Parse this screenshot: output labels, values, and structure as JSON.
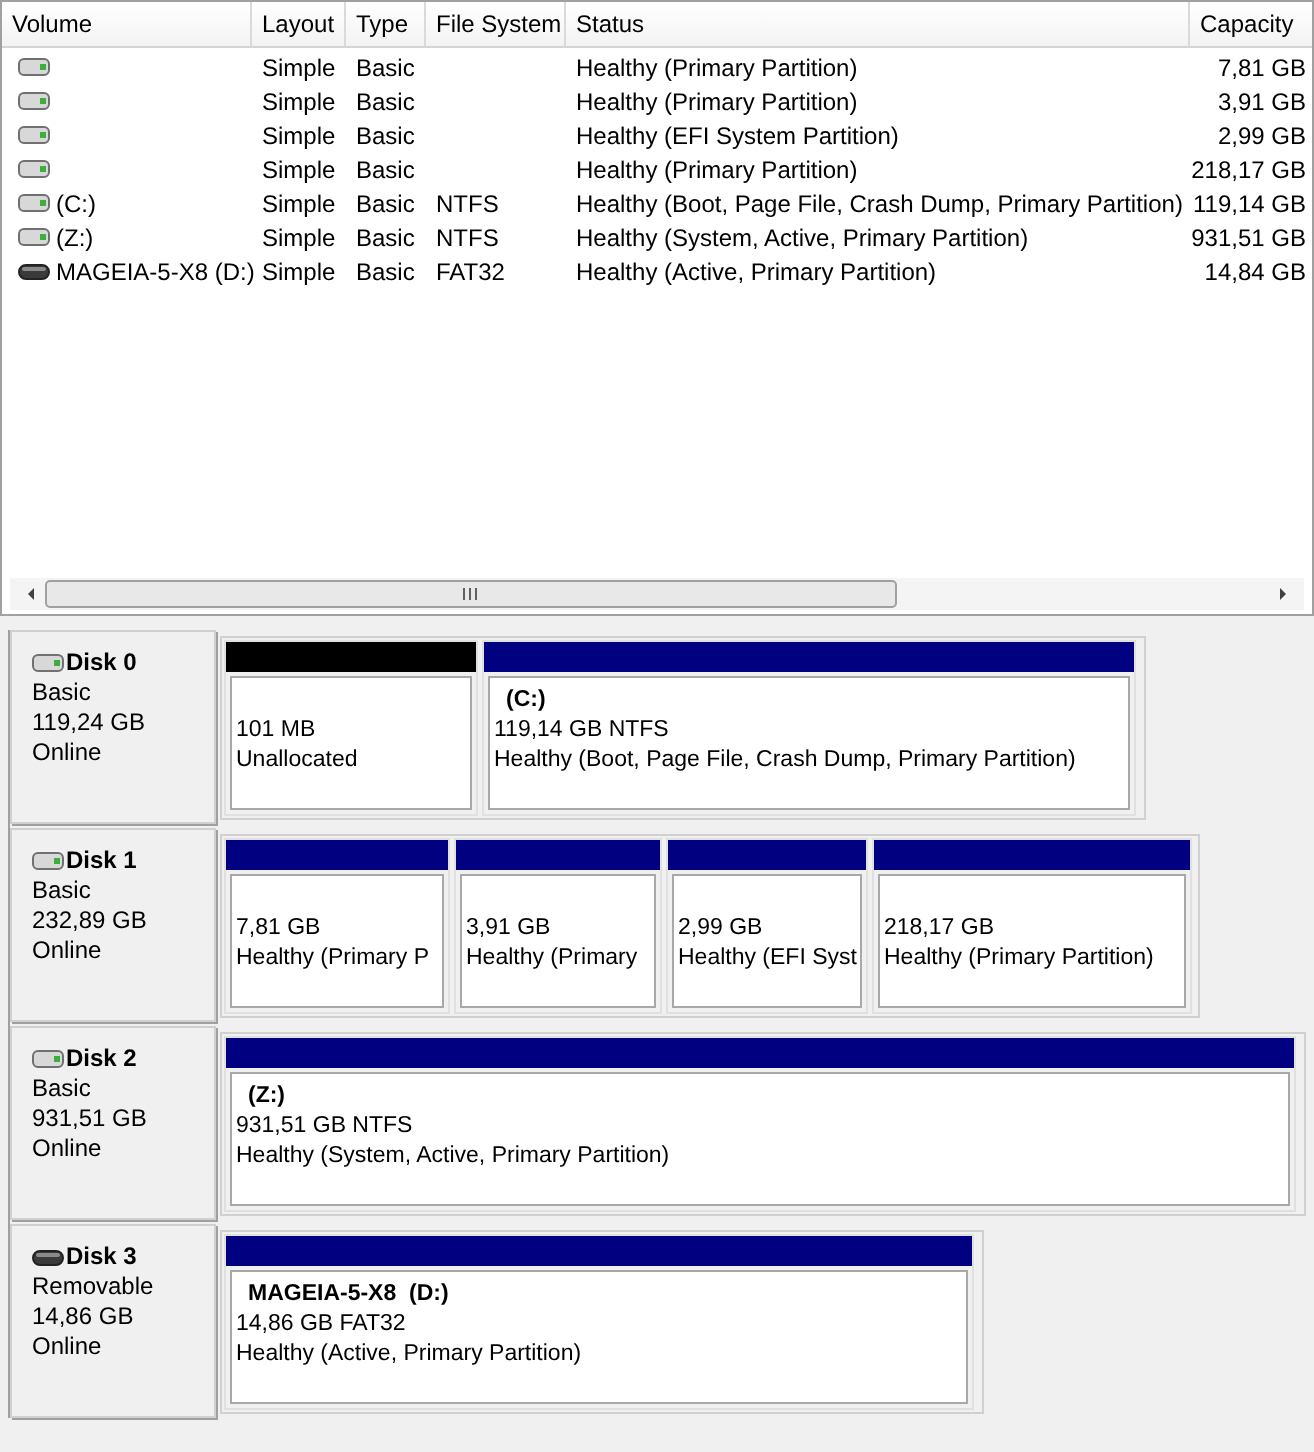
{
  "volume_list": {
    "columns": [
      "Volume",
      "Layout",
      "Type",
      "File System",
      "Status",
      "Capacity"
    ],
    "rows": [
      {
        "kind": "basic",
        "layout": "Simple",
        "type": "Basic",
        "status": "Healthy (Primary Partition)",
        "capacity": "7,81 GB"
      },
      {
        "kind": "basic",
        "layout": "Simple",
        "type": "Basic",
        "status": "Healthy (Primary Partition)",
        "capacity": "3,91 GB"
      },
      {
        "kind": "basic",
        "layout": "Simple",
        "type": "Basic",
        "status": "Healthy (EFI System Partition)",
        "capacity": "2,99 GB"
      },
      {
        "kind": "basic",
        "layout": "Simple",
        "type": "Basic",
        "status": "Healthy (Primary Partition)",
        "capacity": "218,17 GB"
      },
      {
        "kind": "basic",
        "volume": "(C:)",
        "layout": "Simple",
        "type": "Basic",
        "file_system": "NTFS",
        "status": "Healthy (Boot, Page File, Crash Dump, Primary Partition)",
        "capacity": "119,14 GB"
      },
      {
        "kind": "basic",
        "volume": "(Z:)",
        "layout": "Simple",
        "type": "Basic",
        "file_system": "NTFS",
        "status": "Healthy (System, Active, Primary Partition)",
        "capacity": "931,51 GB"
      },
      {
        "kind": "removable",
        "volume": "MAGEIA-5-X8 (D:)",
        "layout": "Simple",
        "type": "Basic",
        "file_system": "FAT32",
        "status": "Healthy (Active, Primary Partition)",
        "capacity": "14,84 GB"
      }
    ]
  },
  "disks": [
    {
      "kind": "basic",
      "name": "Disk 0",
      "type": "Basic",
      "size": "119,24 GB",
      "state": "Online",
      "partitions": [
        {
          "kind": "unallocated",
          "size": "101 MB",
          "status": "Unallocated"
        },
        {
          "kind": "primary",
          "title": "(C:)",
          "size": "119,14 GB NTFS",
          "status": "Healthy (Boot, Page File, Crash Dump, Primary Partition)"
        }
      ]
    },
    {
      "kind": "basic",
      "name": "Disk 1",
      "type": "Basic",
      "size": "232,89 GB",
      "state": "Online",
      "partitions": [
        {
          "kind": "primary",
          "size": "7,81 GB",
          "status": "Healthy (Primary P"
        },
        {
          "kind": "primary",
          "size": "3,91 GB",
          "status": "Healthy (Primary"
        },
        {
          "kind": "primary",
          "size": "2,99 GB",
          "status": "Healthy (EFI Syst"
        },
        {
          "kind": "primary",
          "size": "218,17 GB",
          "status": "Healthy (Primary Partition)"
        }
      ]
    },
    {
      "kind": "basic",
      "name": "Disk 2",
      "type": "Basic",
      "size": "931,51 GB",
      "state": "Online",
      "partitions": [
        {
          "kind": "primary",
          "title": "(Z:)",
          "size": "931,51 GB NTFS",
          "status": "Healthy (System, Active, Primary Partition)"
        }
      ]
    },
    {
      "kind": "removable",
      "name": "Disk 3",
      "type": "Removable",
      "size": "14,86 GB",
      "state": "Online",
      "partitions": [
        {
          "kind": "primary",
          "title": "MAGEIA-5-X8  (D:)",
          "size": "14,86 GB FAT32",
          "status": "Healthy (Active, Primary Partition)"
        }
      ]
    }
  ]
}
